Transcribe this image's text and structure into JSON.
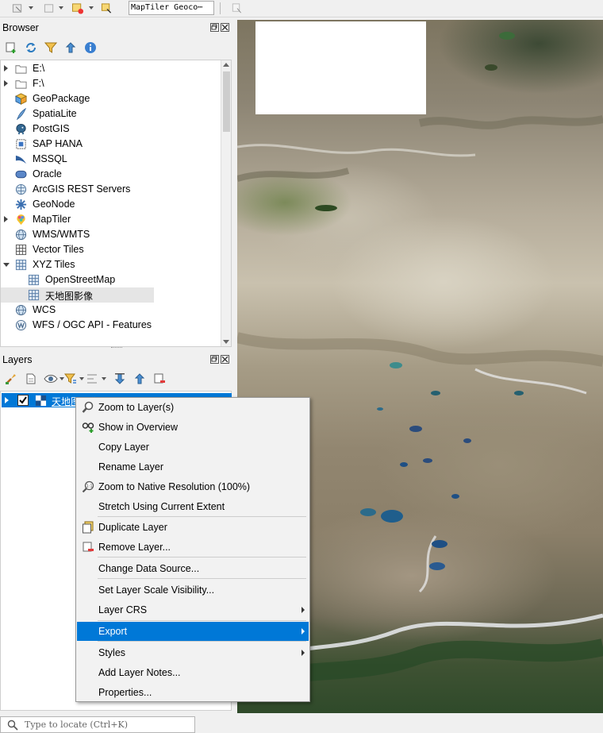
{
  "toolbar": {
    "geocoder_text": "MapTiler Geoco⋯"
  },
  "browser": {
    "title": "Browser",
    "items": [
      {
        "label": "E:\\",
        "icon": "folder-icon",
        "expandable": true
      },
      {
        "label": "F:\\",
        "icon": "folder-icon",
        "expandable": true
      },
      {
        "label": "GeoPackage",
        "icon": "geopackage-icon",
        "expandable": false
      },
      {
        "label": "SpatiaLite",
        "icon": "spatialite-icon",
        "expandable": false
      },
      {
        "label": "PostGIS",
        "icon": "postgis-icon",
        "expandable": false
      },
      {
        "label": "SAP HANA",
        "icon": "sap-hana-icon",
        "expandable": false
      },
      {
        "label": "MSSQL",
        "icon": "mssql-icon",
        "expandable": false
      },
      {
        "label": "Oracle",
        "icon": "oracle-icon",
        "expandable": false
      },
      {
        "label": "ArcGIS REST Servers",
        "icon": "arcgis-icon",
        "expandable": false
      },
      {
        "label": "GeoNode",
        "icon": "geonode-icon",
        "expandable": false
      },
      {
        "label": "MapTiler",
        "icon": "maptiler-icon",
        "expandable": true
      },
      {
        "label": "WMS/WMTS",
        "icon": "globe-icon",
        "expandable": false
      },
      {
        "label": "Vector Tiles",
        "icon": "grid-icon",
        "expandable": false
      },
      {
        "label": "XYZ Tiles",
        "icon": "grid-icon",
        "expandable": true,
        "expanded": true
      },
      {
        "label": "OpenStreetMap",
        "icon": "grid-icon",
        "child": true
      },
      {
        "label": "天地图影像",
        "icon": "grid-icon",
        "child": true,
        "selected": true
      },
      {
        "label": "WCS",
        "icon": "globe-icon",
        "expandable": false
      },
      {
        "label": "WFS / OGC API - Features",
        "icon": "wfs-icon",
        "expandable": false
      }
    ]
  },
  "layers": {
    "title": "Layers",
    "layer_name": "天地图影像",
    "layer_checked": true
  },
  "context_menu": {
    "items": [
      {
        "label": "Zoom to Layer(s)",
        "icon": "zoom-layer-icon"
      },
      {
        "label": "Show in Overview",
        "icon": "overview-icon"
      },
      {
        "label": "Copy Layer"
      },
      {
        "label": "Rename Layer"
      },
      {
        "label": "Zoom to Native Resolution (100%)",
        "icon": "zoom-native-icon"
      },
      {
        "label": "Stretch Using Current Extent"
      },
      {
        "label": "Duplicate Layer",
        "icon": "duplicate-icon"
      },
      {
        "label": "Remove Layer...",
        "icon": "remove-layer-icon"
      },
      {
        "label": "Change Data Source..."
      },
      {
        "label": "Set Layer Scale Visibility..."
      },
      {
        "label": "Layer CRS",
        "submenu": true
      },
      {
        "label": "Export",
        "submenu": true,
        "highlighted": true
      },
      {
        "label": "Styles",
        "submenu": true
      },
      {
        "label": "Add Layer Notes..."
      },
      {
        "label": "Properties..."
      }
    ]
  },
  "locator": {
    "placeholder": "Type to locate (Ctrl+K)"
  },
  "colors": {
    "accent": "#0078d7",
    "menu_bg": "#f2f2f2"
  }
}
